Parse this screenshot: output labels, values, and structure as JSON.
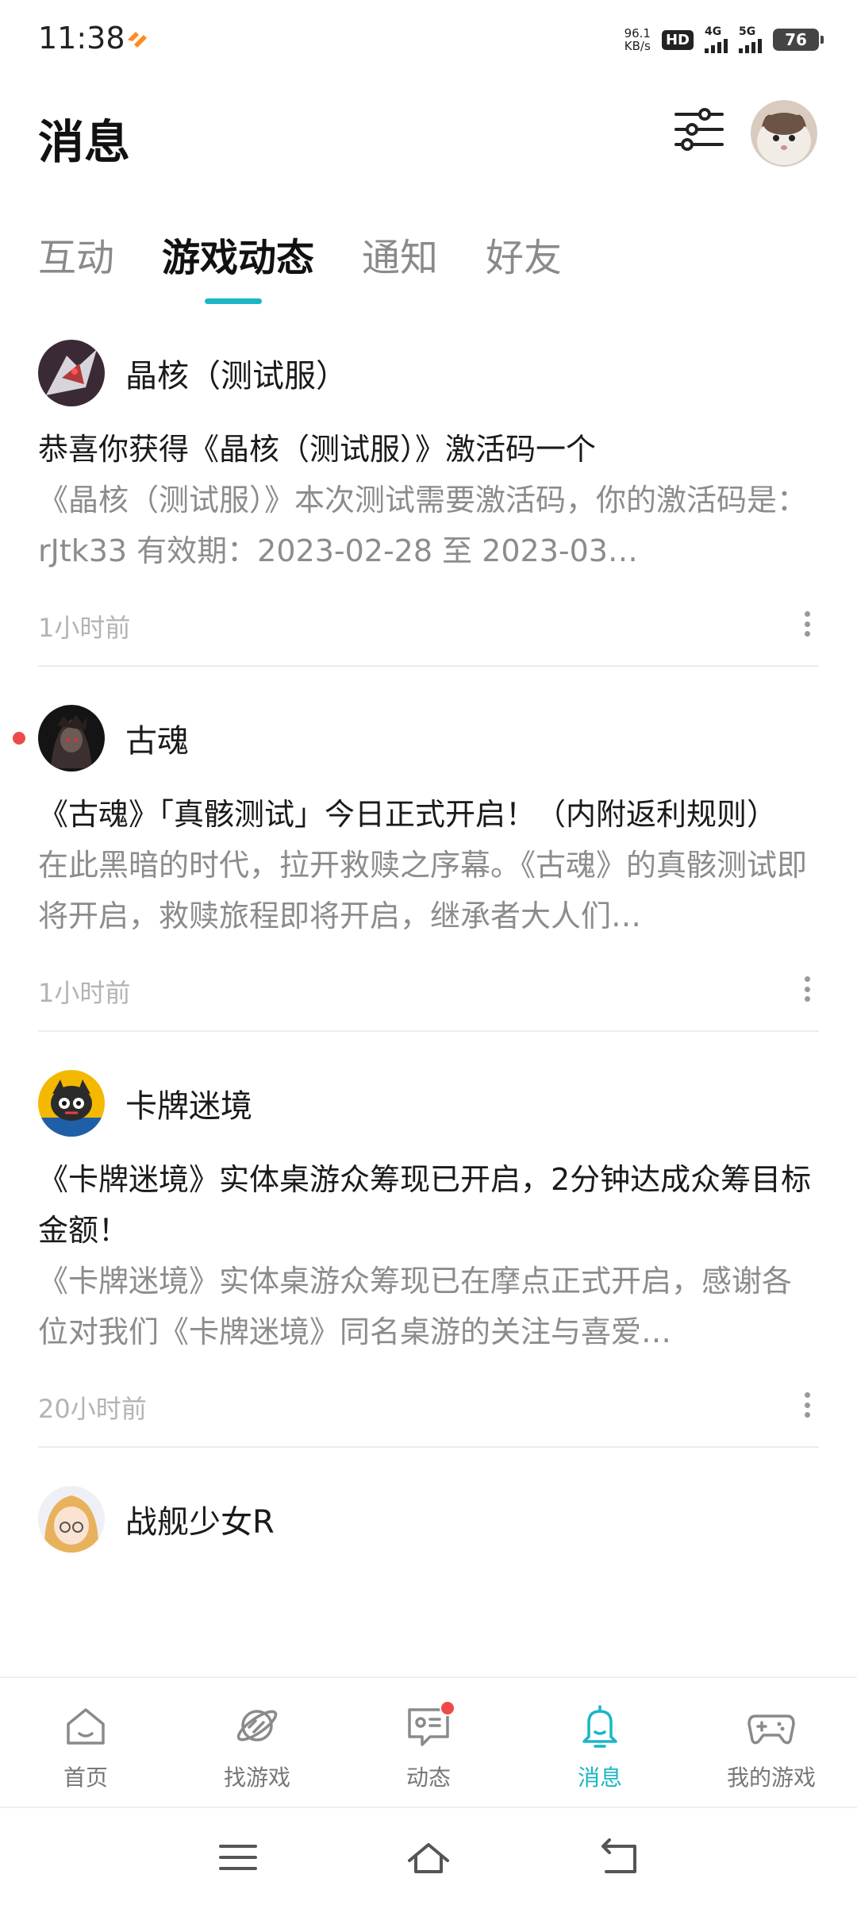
{
  "status_bar": {
    "time": "11:38",
    "net_speed_value": "96.1",
    "net_speed_unit": "KB/s",
    "hd_label": "HD",
    "sim1_label": "4G",
    "sim2_label": "5G",
    "battery": "76"
  },
  "header": {
    "title": "消息",
    "filter_icon": "sliders-icon",
    "avatar_icon": "user-avatar"
  },
  "tabs": [
    {
      "label": "互动",
      "active": false
    },
    {
      "label": "游戏动态",
      "active": true
    },
    {
      "label": "通知",
      "active": false
    },
    {
      "label": "好友",
      "active": false
    }
  ],
  "feed": [
    {
      "name": "晶核（测试服）",
      "title": "恭喜你获得《晶核（测试服）》激活码一个",
      "body": "《晶核（测试服）》本次测试需要激活码，你的激活码是：rJtk33 有效期：2023-02-28 至 2023-03…",
      "time": "1小时前",
      "unread": false
    },
    {
      "name": "古魂",
      "title": "《古魂》「真骸测试」今日正式开启！（内附返利规则）",
      "body": "在此黑暗的时代，拉开救赎之序幕。《古魂》的真骸测试即将开启，救赎旅程即将开启，继承者大人们…",
      "time": "1小时前",
      "unread": true
    },
    {
      "name": "卡牌迷境",
      "title": "《卡牌迷境》实体桌游众筹现已开启，2分钟达成众筹目标金额！",
      "body": "《卡牌迷境》实体桌游众筹现已在摩点正式开启，感谢各位对我们《卡牌迷境》同名桌游的关注与喜爱…",
      "time": "20小时前",
      "unread": false
    },
    {
      "name": "战舰少女R"
    }
  ],
  "bottom_nav": [
    {
      "label": "首页",
      "icon": "home-icon",
      "active": false
    },
    {
      "label": "找游戏",
      "icon": "planet-icon",
      "active": false
    },
    {
      "label": "动态",
      "icon": "chat-icon",
      "active": false,
      "badge": true
    },
    {
      "label": "消息",
      "icon": "bell-icon",
      "active": true
    },
    {
      "label": "我的游戏",
      "icon": "gamepad-icon",
      "active": false
    }
  ],
  "system_nav": {
    "menu_icon": "menu-icon",
    "home_icon": "home-outline-icon",
    "back_icon": "back-icon"
  },
  "colors": {
    "accent": "#19b6c5",
    "unread": "#ee4a4a",
    "secondary_text": "#8c8c8c",
    "time_text": "#b3b3b3"
  }
}
